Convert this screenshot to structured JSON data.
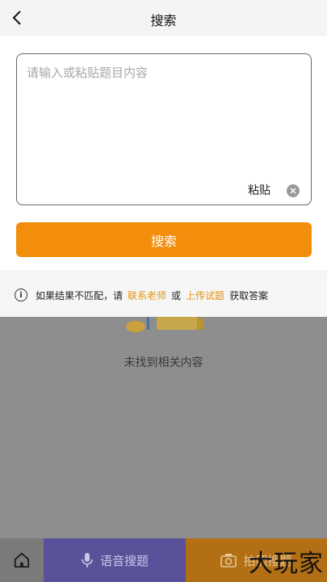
{
  "header": {
    "title": "搜索"
  },
  "search": {
    "placeholder": "请输入或粘贴题目内容",
    "paste_label": "粘贴",
    "button_label": "搜索"
  },
  "notice": {
    "prefix": "如果结果不匹配，请",
    "link_contact": "联系老师",
    "middle": "或",
    "link_upload": "上传试题",
    "suffix": "获取答案"
  },
  "empty_state": {
    "text": "未找到相关内容"
  },
  "bottom_bar": {
    "voice_label": "语音搜题",
    "photo_label": "拍照搜题",
    "watermark": "大玩家"
  },
  "colors": {
    "accent": "#f28e0b",
    "link": "#e8920d",
    "voice": "#59529a"
  }
}
